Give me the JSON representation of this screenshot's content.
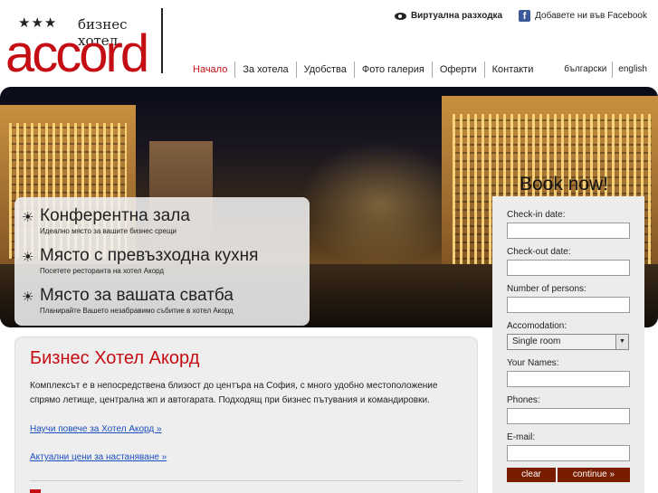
{
  "header": {
    "stars": "★★★",
    "tagline": "бизнес хотел",
    "brand": "accord",
    "virtual_tour": "Виртуална разходка",
    "facebook": "Добавете ни във Facebook"
  },
  "nav": {
    "items": [
      "Начало",
      "За хотела",
      "Удобства",
      "Фото галерия",
      "Оферти",
      "Контакти"
    ]
  },
  "lang": [
    "български",
    "english"
  ],
  "features": [
    {
      "title": "Конферентна зала",
      "sub": "Идеално място за вашите бизнес срещи"
    },
    {
      "title": "Място с превъзходна кухня",
      "sub": "Посетете ресторанта на хотел Акорд"
    },
    {
      "title": "Място за вашата сватба",
      "sub": "Планирайте Вашето незабравимо събитие в хотел Акорд"
    }
  ],
  "booking": {
    "title": "Book now!",
    "checkin": "Check-in date:",
    "checkout": "Check-out date:",
    "persons": "Number of persons:",
    "accom": "Accomodation:",
    "accom_value": "Single room",
    "names": "Your Names:",
    "phones": "Phones:",
    "email": "E-mail:",
    "clear": "clear",
    "continue": "continue »"
  },
  "content": {
    "title": "Бизнес Хотел Акорд",
    "text": "Комплексът е в непосредствена близост до центъра на София, с много удобно местоположение спрямо летище, централна жп и автогарата. Подходящ при бизнес пътувания и командировки.",
    "link1": "Научи повече за Хотел Акорд »",
    "link2": "Актуални цени за настаняване »"
  },
  "colors": {
    "brand_red": "#c40e14",
    "button_brown": "#7a1c00",
    "link_blue": "#1a4fc0"
  },
  "icons": [
    "eye-icon",
    "facebook-icon",
    "sun-icon"
  ]
}
